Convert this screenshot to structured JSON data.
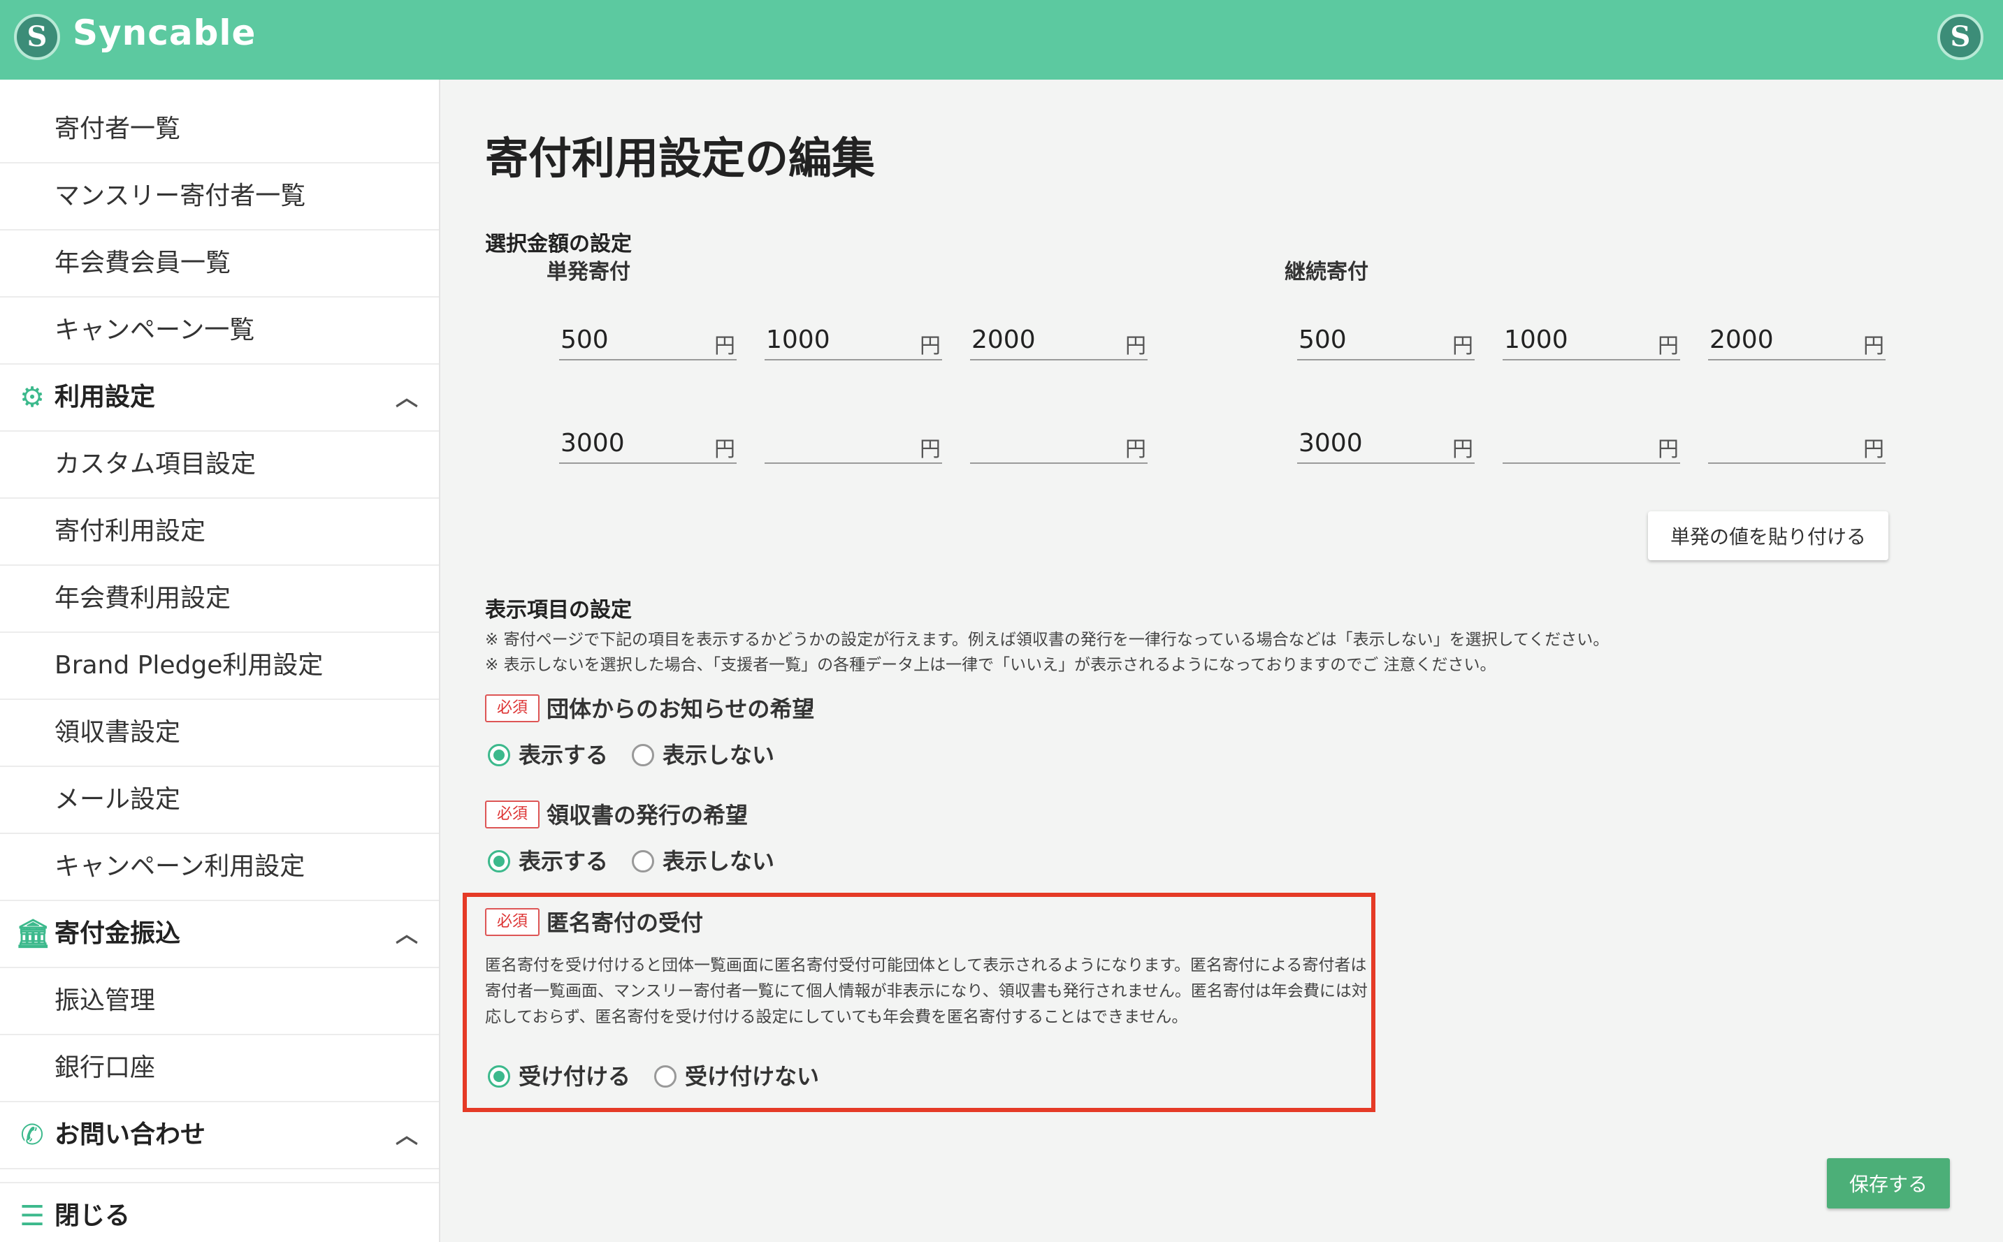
{
  "header": {
    "brand": "Syncable",
    "logo_letter": "S",
    "account_letter": "S"
  },
  "sidebar": {
    "items_top": [
      "寄付者一覧",
      "マンスリー寄付者一覧",
      "年会費会員一覧",
      "キャンペーン一覧"
    ],
    "group_settings": {
      "label": "利用設定",
      "icon": "gear-icon",
      "items": [
        "カスタム項目設定",
        "寄付利用設定",
        "年会費利用設定",
        "Brand Pledge利用設定",
        "領収書設定",
        "メール設定",
        "キャンペーン利用設定"
      ]
    },
    "group_transfer": {
      "label": "寄付金振込",
      "icon": "bank-icon",
      "items": [
        "振込管理",
        "銀行口座"
      ]
    },
    "group_contact": {
      "label": "お問い合わせ",
      "icon": "phone-icon"
    },
    "close": {
      "label": "閉じる",
      "icon": "menu-icon"
    }
  },
  "main": {
    "title": "寄付利用設定の編集",
    "amounts": {
      "label": "選択金額の設定",
      "unit": "円",
      "single": {
        "label": "単発寄付",
        "values": [
          "500",
          "1000",
          "2000",
          "3000",
          "",
          ""
        ]
      },
      "monthly": {
        "label": "継続寄付",
        "values": [
          "500",
          "1000",
          "2000",
          "3000",
          "",
          ""
        ]
      },
      "paste_button": "単発の値を貼り付ける"
    },
    "display": {
      "label": "表示項目の設定",
      "notes": [
        "※ 寄付ページで下記の項目を表示するかどうかの設定が行えます。例えば領収書の発行を一律行なっている場合などは「表示しない」を選択してください。",
        "※ 表示しないを選択した場合、「支援者一覧」の各種データ上は一律で「いいえ」が表示されるようになっておりますのでご 注意ください。"
      ],
      "required_badge": "必須",
      "news": {
        "title": "団体からのお知らせの希望",
        "options": [
          "表示する",
          "表示しない"
        ],
        "selected": 0
      },
      "receipt": {
        "title": "領収書の発行の希望",
        "options": [
          "表示する",
          "表示しない"
        ],
        "selected": 0
      },
      "anonymous": {
        "title": "匿名寄付の受付",
        "description": "匿名寄付を受け付けると団体一覧画面に匿名寄付受付可能団体として表示されるようになります。匿名寄付による寄付者は寄付者一覧画面、マンスリー寄付者一覧にて個人情報が非表示になり、領収書も発行されません。匿名寄付は年会費には対応しておらず、匿名寄付を受け付ける設定にしていても年会費を匿名寄付することはできません。",
        "options": [
          "受け付ける",
          "受け付けない"
        ],
        "selected": 0
      }
    },
    "save_button": "保存する",
    "colors": {
      "accent": "#5cc9a0",
      "highlight": "#e53a26",
      "save": "#4caf78"
    }
  }
}
